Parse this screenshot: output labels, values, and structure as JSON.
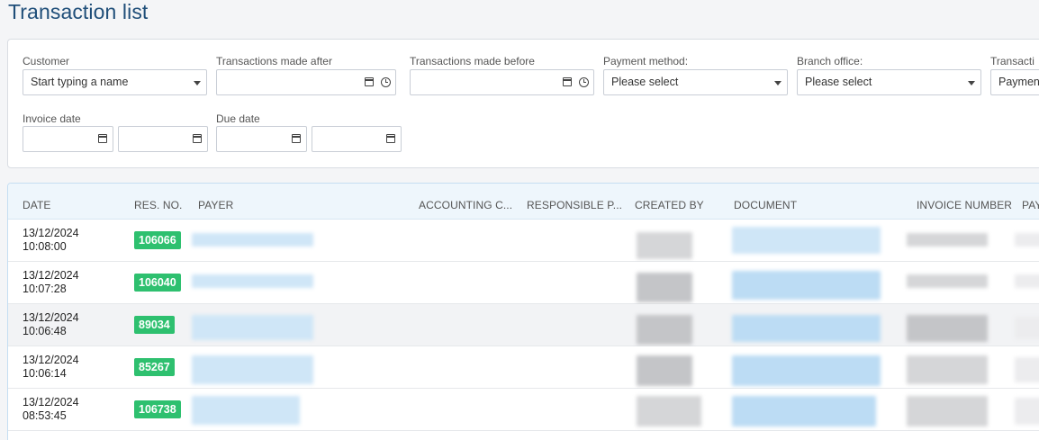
{
  "page_title": "Transaction list",
  "filters": {
    "customer": {
      "label": "Customer",
      "value": "Start typing a name"
    },
    "after": {
      "label": "Transactions made after"
    },
    "before": {
      "label": "Transactions made before"
    },
    "payment_method": {
      "label": "Payment method:",
      "value": "Please select"
    },
    "branch_office": {
      "label": "Branch office:",
      "value": "Please select"
    },
    "transaction_type": {
      "label": "Transacti",
      "value": "Paymen"
    },
    "invoice_date": {
      "label": "Invoice date"
    },
    "due_date": {
      "label": "Due date"
    }
  },
  "table": {
    "columns": [
      "DATE",
      "RES. NO.",
      "PAYER",
      "ACCOUNTING C...",
      "RESPONSIBLE P...",
      "CREATED BY",
      "DOCUMENT",
      "INVOICE NUMBER",
      "PAY"
    ],
    "rows": [
      {
        "date": "13/12/2024",
        "time": "10:08:00",
        "res_no": "106066"
      },
      {
        "date": "13/12/2024",
        "time": "10:07:28",
        "res_no": "106040"
      },
      {
        "date": "13/12/2024",
        "time": "10:06:48",
        "res_no": "89034"
      },
      {
        "date": "13/12/2024",
        "time": "10:06:14",
        "res_no": "85267"
      },
      {
        "date": "13/12/2024",
        "time": "08:53:45",
        "res_no": "106738"
      }
    ]
  },
  "colors": {
    "accent": "#1f4e79",
    "badge": "#2ec06f",
    "header_bg": "#eef6fc"
  }
}
